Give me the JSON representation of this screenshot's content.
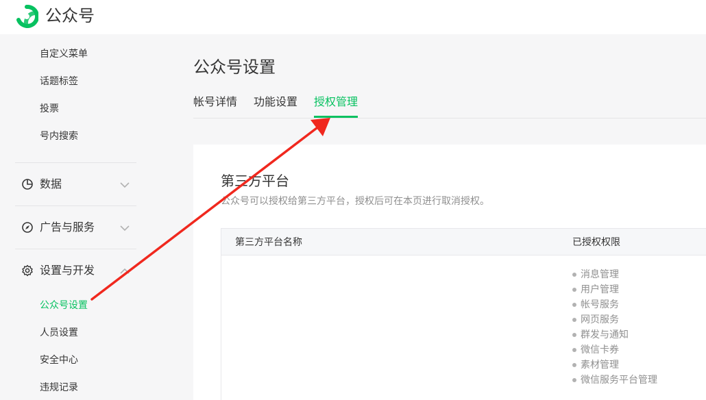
{
  "app": {
    "title": "公众号",
    "logo_icon": "wechat-official-logo-icon",
    "brand_color": "#07c160"
  },
  "sidebar": {
    "top_items": [
      {
        "label": "自定义菜单"
      },
      {
        "label": "话题标签"
      },
      {
        "label": "投票"
      },
      {
        "label": "号内搜索"
      }
    ],
    "groups": [
      {
        "label": "数据",
        "icon": "pie-chart-icon",
        "expanded": false
      },
      {
        "label": "广告与服务",
        "icon": "compass-icon",
        "expanded": false
      },
      {
        "label": "设置与开发",
        "icon": "gear-icon",
        "expanded": true
      }
    ],
    "settings_items": [
      {
        "label": "公众号设置",
        "active": true
      },
      {
        "label": "人员设置"
      },
      {
        "label": "安全中心"
      },
      {
        "label": "违规记录"
      }
    ]
  },
  "main": {
    "title": "公众号设置",
    "tabs": [
      {
        "label": "帐号详情"
      },
      {
        "label": "功能设置"
      },
      {
        "label": "授权管理",
        "active": true
      }
    ]
  },
  "card": {
    "title": "第三方平台",
    "description": "公众号可以授权给第三方平台，授权后可在本页进行取消授权。",
    "table": {
      "columns": [
        "第三方平台名称",
        "已授权权限"
      ],
      "rows": [
        {
          "name": "",
          "permissions": [
            "消息管理",
            "用户管理",
            "帐号服务",
            "网页服务",
            "群发与通知",
            "微信卡券",
            "素材管理",
            "微信服务平台管理"
          ]
        }
      ]
    }
  },
  "annotation": {
    "arrow_color": "#f0281e"
  }
}
